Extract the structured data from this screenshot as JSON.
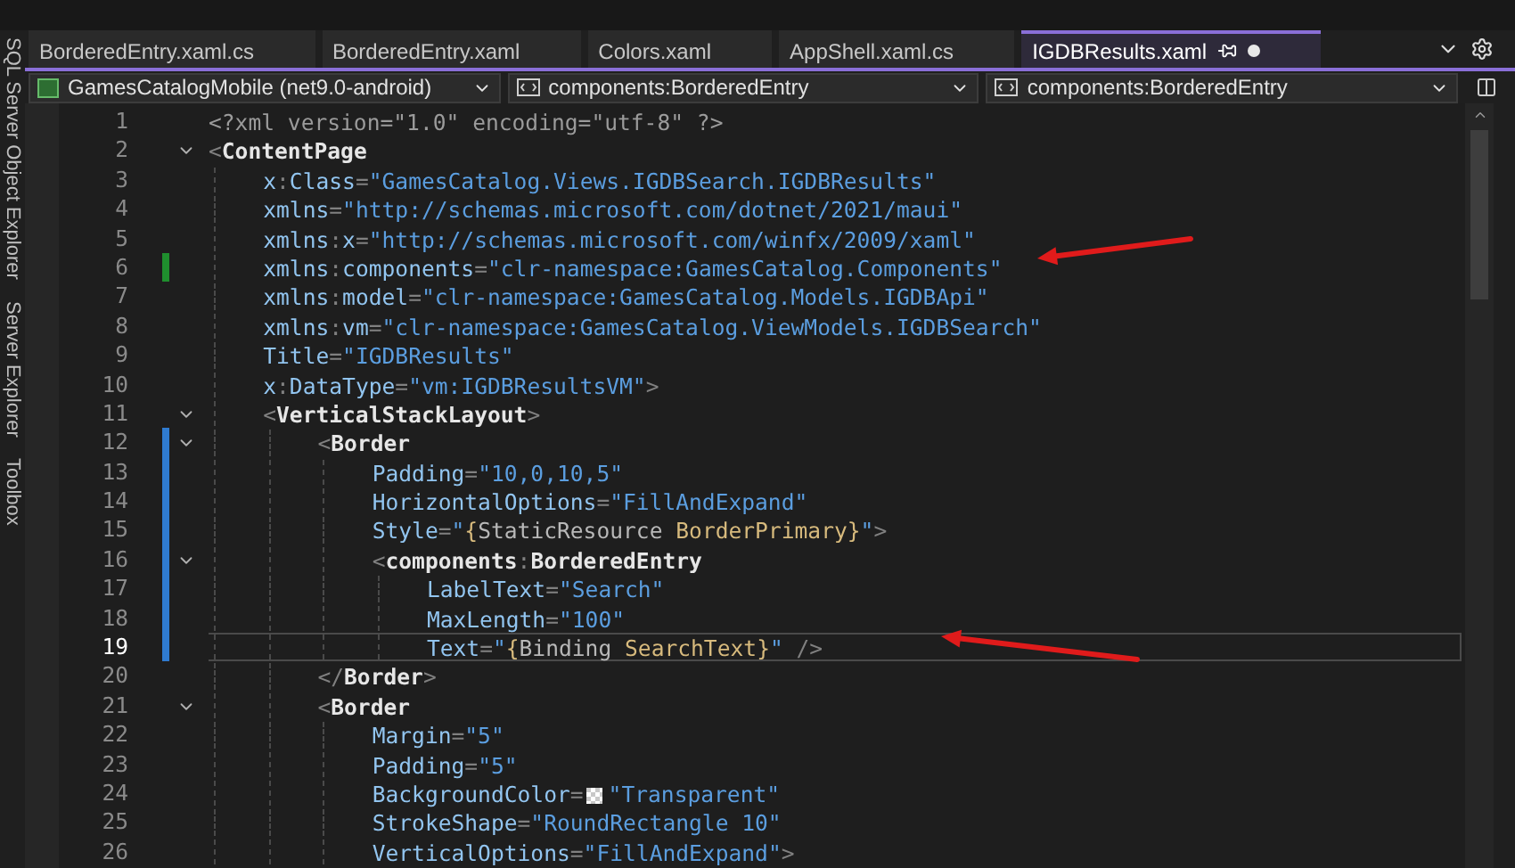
{
  "tabs": [
    {
      "label": "BorderedEntry.xaml.cs",
      "selected": false,
      "pinned": false,
      "modified": false
    },
    {
      "label": "BorderedEntry.xaml",
      "selected": false,
      "pinned": false,
      "modified": false
    },
    {
      "label": "Colors.xaml",
      "selected": false,
      "pinned": false,
      "modified": false
    },
    {
      "label": "AppShell.xaml.cs",
      "selected": false,
      "pinned": false,
      "modified": false
    },
    {
      "label": "IGDBResults.xaml",
      "selected": true,
      "pinned": true,
      "modified": true
    }
  ],
  "navigation_bar": [
    {
      "kind": "project",
      "text": "GamesCatalogMobile (net9.0-android)"
    },
    {
      "kind": "element",
      "text": "components:BorderedEntry"
    },
    {
      "kind": "element",
      "text": "components:BorderedEntry"
    }
  ],
  "side_tools": [
    "SQL Server Object Explorer",
    "Server Explorer",
    "Toolbox"
  ],
  "lines": [
    {
      "number": "1",
      "current": false,
      "fold": false,
      "changed": false,
      "tokens": [
        {
          "kind": "decl",
          "text": "<?xml version=\"1.0\" encoding=\"utf-8\" ?>"
        }
      ]
    },
    {
      "number": "2",
      "current": false,
      "fold": true,
      "changed": false,
      "tokens": [
        {
          "kind": "punct",
          "text": "<"
        },
        {
          "kind": "tag",
          "text": "ContentPage"
        }
      ],
      "children": [
        {
          "number": "3",
          "current": false,
          "fold": false,
          "changed": false,
          "tokens": [
            {
              "kind": "attr",
              "text": "x"
            },
            {
              "kind": "punct",
              "text": ":"
            },
            {
              "kind": "attr",
              "text": "Class"
            },
            {
              "kind": "punct",
              "text": "="
            },
            {
              "kind": "value",
              "text": "\"GamesCatalog.Views.IGDBSearch.IGDBResults\""
            }
          ]
        },
        {
          "number": "4",
          "current": false,
          "fold": false,
          "changed": false,
          "tokens": [
            {
              "kind": "attr",
              "text": "xmlns"
            },
            {
              "kind": "punct",
              "text": "="
            },
            {
              "kind": "value",
              "text": "\"http://schemas.microsoft.com/dotnet/2021/maui\""
            }
          ]
        },
        {
          "number": "5",
          "current": false,
          "fold": false,
          "changed": false,
          "tokens": [
            {
              "kind": "attr",
              "text": "xmlns"
            },
            {
              "kind": "punct",
              "text": ":"
            },
            {
              "kind": "attr",
              "text": "x"
            },
            {
              "kind": "punct",
              "text": "="
            },
            {
              "kind": "value",
              "text": "\"http://schemas.microsoft.com/winfx/2009/xaml\""
            }
          ]
        },
        {
          "number": "6",
          "current": false,
          "fold": false,
          "changed": true,
          "color": "#1f8f2e",
          "tokens": [
            {
              "kind": "attr",
              "text": "xmlns"
            },
            {
              "kind": "punct",
              "text": ":"
            },
            {
              "kind": "attr",
              "text": "components"
            },
            {
              "kind": "punct",
              "text": "="
            },
            {
              "kind": "value",
              "text": "\"clr-namespace:GamesCatalog.Components\""
            }
          ]
        },
        {
          "number": "7",
          "current": false,
          "fold": false,
          "changed": false,
          "tokens": [
            {
              "kind": "attr",
              "text": "xmlns"
            },
            {
              "kind": "punct",
              "text": ":"
            },
            {
              "kind": "attr",
              "text": "model"
            },
            {
              "kind": "punct",
              "text": "="
            },
            {
              "kind": "value",
              "text": "\"clr-namespace:GamesCatalog.Models.IGDBApi\""
            }
          ]
        },
        {
          "number": "8",
          "current": false,
          "fold": false,
          "changed": false,
          "tokens": [
            {
              "kind": "attr",
              "text": "xmlns"
            },
            {
              "kind": "punct",
              "text": ":"
            },
            {
              "kind": "attr",
              "text": "vm"
            },
            {
              "kind": "punct",
              "text": "="
            },
            {
              "kind": "value",
              "text": "\"clr-namespace:GamesCatalog.ViewModels.IGDBSearch\""
            }
          ]
        },
        {
          "number": "9",
          "current": false,
          "fold": false,
          "changed": false,
          "tokens": [
            {
              "kind": "attr",
              "text": "Title"
            },
            {
              "kind": "punct",
              "text": "="
            },
            {
              "kind": "value",
              "text": "\"IGDBResults\""
            }
          ]
        },
        {
          "number": "10",
          "current": false,
          "fold": false,
          "changed": false,
          "tokens": [
            {
              "kind": "attr",
              "text": "x"
            },
            {
              "kind": "punct",
              "text": ":"
            },
            {
              "kind": "attr",
              "text": "DataType"
            },
            {
              "kind": "punct",
              "text": "="
            },
            {
              "kind": "value",
              "text": "\"vm:IGDBResultsVM\""
            },
            {
              "kind": "punct",
              "text": ">"
            }
          ]
        },
        {
          "number": "11",
          "current": false,
          "fold": true,
          "changed": false,
          "tokens": [
            {
              "kind": "punct",
              "text": "<"
            },
            {
              "kind": "tag",
              "text": "VerticalStackLayout"
            },
            {
              "kind": "punct",
              "text": ">"
            }
          ],
          "children": [
            {
              "number": "12",
              "current": false,
              "fold": true,
              "changed": true,
              "color": "#2f7bd0",
              "tokens": [
                {
                  "kind": "punct",
                  "text": "<"
                },
                {
                  "kind": "tag",
                  "text": "Border"
                }
              ],
              "children": [
                {
                  "number": "13",
                  "current": false,
                  "fold": false,
                  "changed": true,
                  "color": "#2f7bd0",
                  "tokens": [
                    {
                      "kind": "attr",
                      "text": "Padding"
                    },
                    {
                      "kind": "punct",
                      "text": "="
                    },
                    {
                      "kind": "value",
                      "text": "\"10,0,10,5\""
                    }
                  ]
                },
                {
                  "number": "14",
                  "current": false,
                  "fold": false,
                  "changed": true,
                  "color": "#2f7bd0",
                  "tokens": [
                    {
                      "kind": "attr",
                      "text": "HorizontalOptions"
                    },
                    {
                      "kind": "punct",
                      "text": "="
                    },
                    {
                      "kind": "value",
                      "text": "\"FillAndExpand\""
                    }
                  ]
                },
                {
                  "number": "15",
                  "current": false,
                  "fold": false,
                  "changed": true,
                  "color": "#2f7bd0",
                  "tokens": [
                    {
                      "kind": "attr",
                      "text": "Style"
                    },
                    {
                      "kind": "punct",
                      "text": "="
                    },
                    {
                      "kind": "value",
                      "text": "\""
                    },
                    {
                      "kind": "brace",
                      "text": "{"
                    },
                    {
                      "kind": "ext",
                      "text": "StaticResource "
                    },
                    {
                      "kind": "ref",
                      "text": "BorderPrimary"
                    },
                    {
                      "kind": "brace",
                      "text": "}"
                    },
                    {
                      "kind": "value",
                      "text": "\""
                    },
                    {
                      "kind": "punct",
                      "text": ">"
                    }
                  ]
                },
                {
                  "number": "16",
                  "current": false,
                  "fold": true,
                  "changed": true,
                  "color": "#2f7bd0",
                  "tokens": [
                    {
                      "kind": "punct",
                      "text": "<"
                    },
                    {
                      "kind": "tag",
                      "text": "components"
                    },
                    {
                      "kind": "punct",
                      "text": ":"
                    },
                    {
                      "kind": "tag",
                      "text": "BorderedEntry"
                    }
                  ],
                  "children": [
                    {
                      "number": "17",
                      "current": false,
                      "fold": false,
                      "changed": true,
                      "color": "#2f7bd0",
                      "tokens": [
                        {
                          "kind": "attr",
                          "text": "LabelText"
                        },
                        {
                          "kind": "punct",
                          "text": "="
                        },
                        {
                          "kind": "value",
                          "text": "\"Search\""
                        }
                      ]
                    },
                    {
                      "number": "18",
                      "current": false,
                      "fold": false,
                      "changed": true,
                      "color": "#2f7bd0",
                      "tokens": [
                        {
                          "kind": "attr",
                          "text": "MaxLength"
                        },
                        {
                          "kind": "punct",
                          "text": "="
                        },
                        {
                          "kind": "value",
                          "text": "\"100\""
                        }
                      ]
                    },
                    {
                      "number": "19",
                      "current": true,
                      "fold": false,
                      "changed": true,
                      "color": "#2f7bd0",
                      "tokens": [
                        {
                          "kind": "attr",
                          "text": "Text"
                        },
                        {
                          "kind": "punct",
                          "text": "="
                        },
                        {
                          "kind": "value",
                          "text": "\""
                        },
                        {
                          "kind": "brace",
                          "text": "{"
                        },
                        {
                          "kind": "ext",
                          "text": "Binding "
                        },
                        {
                          "kind": "ref",
                          "text": "SearchText"
                        },
                        {
                          "kind": "brace",
                          "text": "}"
                        },
                        {
                          "kind": "value",
                          "text": "\""
                        },
                        {
                          "kind": "punct",
                          "text": " />"
                        }
                      ]
                    }
                  ]
                }
              ]
            },
            {
              "number": "20",
              "current": false,
              "fold": false,
              "changed": false,
              "tokens": [
                {
                  "kind": "punct",
                  "text": "</"
                },
                {
                  "kind": "tag",
                  "text": "Border"
                },
                {
                  "kind": "punct",
                  "text": ">"
                }
              ]
            },
            {
              "number": "21",
              "current": false,
              "fold": true,
              "changed": false,
              "tokens": [
                {
                  "kind": "punct",
                  "text": "<"
                },
                {
                  "kind": "tag",
                  "text": "Border"
                }
              ],
              "children": [
                {
                  "number": "22",
                  "current": false,
                  "fold": false,
                  "changed": false,
                  "tokens": [
                    {
                      "kind": "attr",
                      "text": "Margin"
                    },
                    {
                      "kind": "punct",
                      "text": "="
                    },
                    {
                      "kind": "value",
                      "text": "\"5\""
                    }
                  ]
                },
                {
                  "number": "23",
                  "current": false,
                  "fold": false,
                  "changed": false,
                  "tokens": [
                    {
                      "kind": "attr",
                      "text": "Padding"
                    },
                    {
                      "kind": "punct",
                      "text": "="
                    },
                    {
                      "kind": "value",
                      "text": "\"5\""
                    }
                  ]
                },
                {
                  "number": "24",
                  "current": false,
                  "fold": false,
                  "changed": false,
                  "tokens": [
                    {
                      "kind": "attr",
                      "text": "BackgroundColor"
                    },
                    {
                      "kind": "punct",
                      "text": "="
                    },
                    {
                      "kind": "swatch"
                    },
                    {
                      "kind": "value",
                      "text": "\"Transparent\""
                    }
                  ]
                },
                {
                  "number": "25",
                  "current": false,
                  "fold": false,
                  "changed": false,
                  "tokens": [
                    {
                      "kind": "attr",
                      "text": "StrokeShape"
                    },
                    {
                      "kind": "punct",
                      "text": "="
                    },
                    {
                      "kind": "value",
                      "text": "\"RoundRectangle 10\""
                    }
                  ]
                },
                {
                  "number": "26",
                  "current": false,
                  "fold": false,
                  "changed": false,
                  "tokens": [
                    {
                      "kind": "attr",
                      "text": "VerticalOptions"
                    },
                    {
                      "kind": "punct",
                      "text": "="
                    },
                    {
                      "kind": "value",
                      "text": "\"FillAndExpand\""
                    },
                    {
                      "kind": "punct",
                      "text": ">"
                    }
                  ]
                }
              ]
            }
          ]
        }
      ]
    }
  ]
}
